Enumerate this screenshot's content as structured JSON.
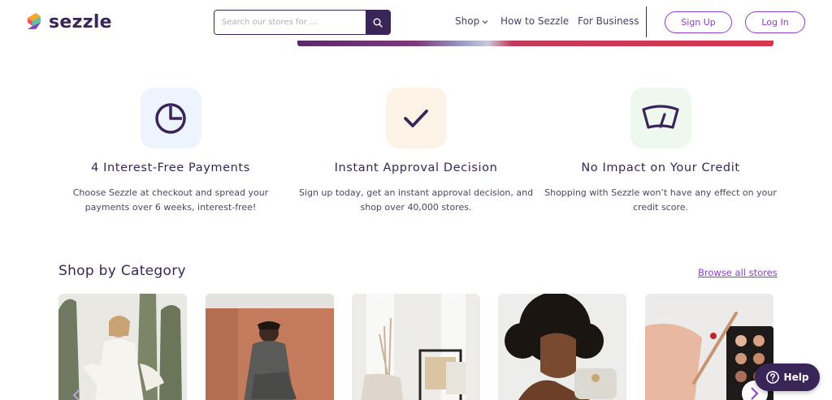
{
  "brand": {
    "name": "sezzle",
    "accent": "#8a3fc9",
    "primary": "#392558"
  },
  "search": {
    "placeholder": "Search our stores for ...",
    "icon": "search-icon"
  },
  "nav": {
    "shop": "Shop",
    "how": "How to Sezzle",
    "business": "For Business"
  },
  "auth": {
    "signup": "Sign Up",
    "login": "Log In"
  },
  "features": [
    {
      "icon": "pie-chart-icon",
      "title": "4 Interest-Free Payments",
      "text": "Choose Sezzle at checkout and spread your payments over 6 weeks, interest-free!"
    },
    {
      "icon": "checkmark-icon",
      "title": "Instant Approval Decision",
      "text": "Sign up today, get an instant approval decision, and shop over 40,000 stores."
    },
    {
      "icon": "credit-gauge-icon",
      "title": "No Impact on Your Credit",
      "text": "Shopping with Sezzle won’t have any effect on your credit score."
    }
  ],
  "category": {
    "title": "Shop by Category",
    "browse": "Browse all stores",
    "cards": [
      "women-fashion",
      "men-fashion",
      "home-decor",
      "accessories",
      "beauty"
    ]
  },
  "help": {
    "label": "Help",
    "icon": "question-icon"
  }
}
